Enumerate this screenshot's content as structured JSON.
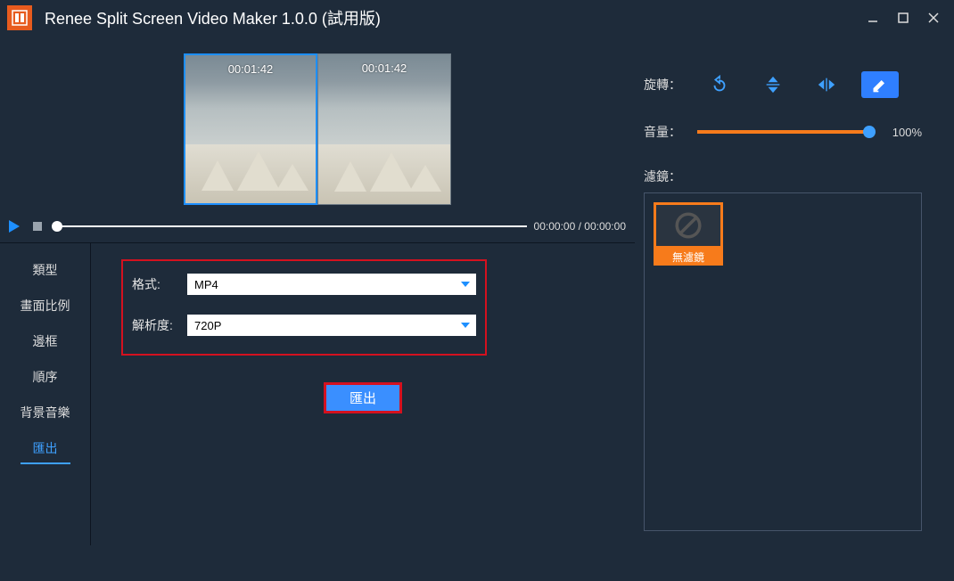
{
  "titlebar": {
    "title": "Renee Split Screen Video Maker 1.0.0 (試用版)"
  },
  "preview": {
    "clips": [
      {
        "time": "00:01:42",
        "selected": true
      },
      {
        "time": "00:01:42",
        "selected": false
      }
    ]
  },
  "playback": {
    "current": "00:00:00",
    "total": "00:00:00"
  },
  "tabs": [
    {
      "key": "type",
      "label": "類型",
      "active": false
    },
    {
      "key": "ratio",
      "label": "畫面比例",
      "active": false
    },
    {
      "key": "border",
      "label": "邊框",
      "active": false
    },
    {
      "key": "order",
      "label": "順序",
      "active": false
    },
    {
      "key": "bgm",
      "label": "背景音樂",
      "active": false
    },
    {
      "key": "export",
      "label": "匯出",
      "active": true
    }
  ],
  "export": {
    "format_label": "格式:",
    "format_value": "MP4",
    "resolution_label": "解析度:",
    "resolution_value": "720P",
    "button": "匯出"
  },
  "right": {
    "rotate_label": "旋轉：",
    "volume_label": "音量：",
    "volume_value": "100%",
    "filter_label": "濾鏡：",
    "filters": [
      {
        "name": "無濾鏡"
      }
    ]
  }
}
